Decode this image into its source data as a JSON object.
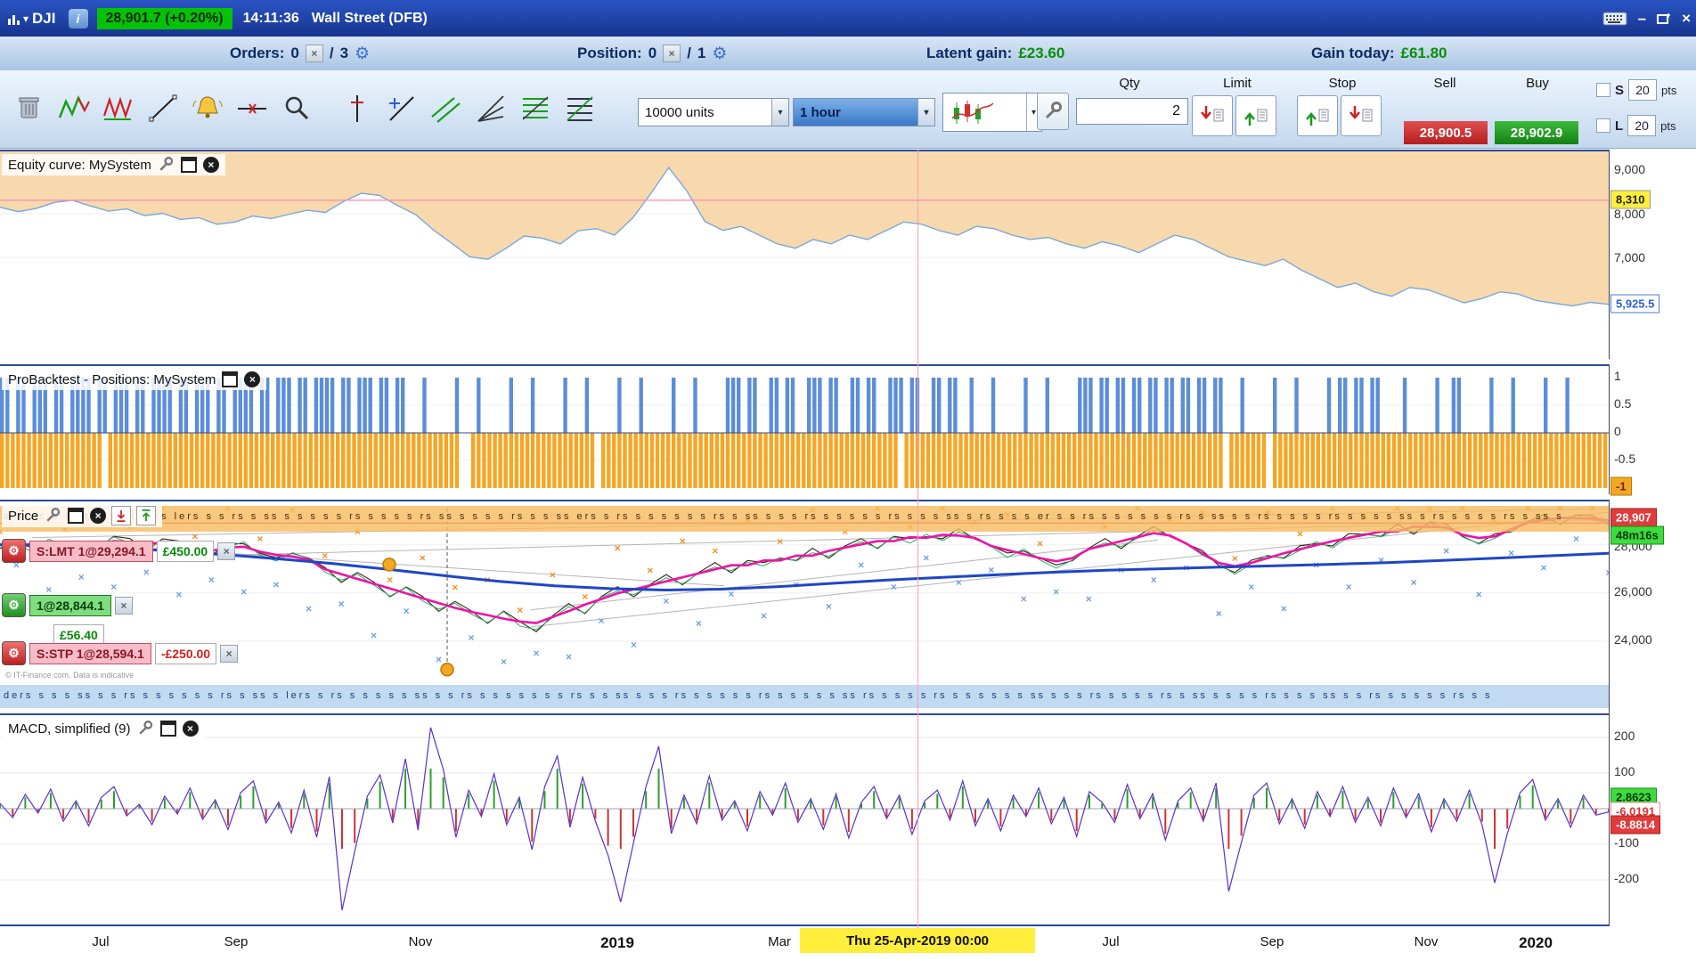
{
  "titlebar": {
    "symbol": "DJI",
    "info_icon": "i",
    "price_badge": "28,901.7 (+0.20%)",
    "time": "14:11:36",
    "market": "Wall Street (DFB)"
  },
  "icons": {
    "dropdown": "▾",
    "close": "×",
    "minimize": "–",
    "gear": "⚙"
  },
  "statusbar": {
    "orders_label": "Orders:",
    "orders_count": "0",
    "orders_sep": "/",
    "orders_total": "3",
    "position_label": "Position:",
    "position_count": "0",
    "position_sep": "/",
    "position_total": "1",
    "latent_label": "Latent gain:",
    "latent_value": "£23.60",
    "today_label": "Gain today:",
    "today_value": "£61.80"
  },
  "toolbar": {
    "units": "10000 units",
    "timeframe": "1 hour",
    "qty_label": "Qty",
    "qty_value": "2",
    "limit_label": "Limit",
    "stop_label": "Stop",
    "sell_label": "Sell",
    "buy_label": "Buy",
    "sell_price": "28,900.5",
    "buy_price": "28,902.9",
    "s_label": "S",
    "l_label": "L",
    "s_pts": "20",
    "l_pts": "20",
    "pts": "pts",
    "pts2": "pts"
  },
  "panels": {
    "equity": {
      "title": "Equity curve: MySystem",
      "axis": [
        "9,000",
        "8,000",
        "7,000"
      ],
      "marker": "8,310",
      "current": "5,925.5"
    },
    "positions": {
      "title": "ProBacktest - Positions: MySystem",
      "axis": [
        "1",
        "0.5",
        "0",
        "-0.5"
      ],
      "current": "-1"
    },
    "price": {
      "title": "Price",
      "price_tag": "28,907",
      "countdown": "48m16s",
      "axis": [
        "28,000",
        "26,000",
        "24,000"
      ],
      "orders": [
        {
          "type": "S:LMT 1@29,294.1",
          "value": "£450.00"
        },
        {
          "type": "1@28,844.1",
          "value": "£56.40"
        },
        {
          "type": "S:STP 1@28,594.1",
          "value": "-£250.00"
        }
      ],
      "watermark": "© IT-Finance.com. Data is indicative",
      "top_signals": "s ssss s s rs s s er s rs lers s s rs s ss s s s s s rs s s s s rs ss s s s s rs s s ss ers s rs s s s s s s rs s ss s s s rs s s s s s rs s s s ss s rs s s s er s s rs s s s s s s rs s ss s s rs s s s s rs s s s s ss s rs s s s s rs s ss s",
      "bottom_signals": "ders s s s ss s s rs s s s s s s rs s ss s lers s rs s s s s s ss s s rs s s s s s s s rs s s ss s s s rs s s s s s rs s s s s s ss rs s s s s rs s s s s s s ss s s s rs s s s s rs s ss s s s s rs s s s ss s s rs s s s s s rs s s"
    },
    "macd": {
      "title": "MACD, simplified (9)",
      "axis": [
        "200",
        "100",
        "-100",
        "-200"
      ],
      "tag_pos": "2.8623",
      "tag_mid": "-6.0191",
      "tag_neg": "-8.8814"
    }
  },
  "time_axis": {
    "labels": [
      "Jul",
      "Sep",
      "Nov",
      "2019",
      "Mar",
      "Jul",
      "Sep",
      "Nov",
      "2020"
    ],
    "crosshair": "Thu 25-Apr-2019 00:00"
  },
  "chart_data": {
    "equity": {
      "type": "line",
      "ylim": [
        5450,
        9430
      ],
      "ticks": [
        9000,
        8000,
        7000
      ],
      "marker_line": 8310,
      "last": 5925.5,
      "values": [
        8150,
        8050,
        8120,
        8260,
        8310,
        8180,
        8060,
        8110,
        7960,
        8010,
        7870,
        7910,
        7760,
        7810,
        7950,
        7890,
        7990,
        8080,
        8030,
        8280,
        8470,
        8420,
        8190,
        7980,
        7620,
        7320,
        7010,
        6960,
        7210,
        7490,
        7440,
        7310,
        7610,
        7660,
        7510,
        7900,
        8460,
        9060,
        8520,
        7820,
        7620,
        7710,
        7510,
        7310,
        7210,
        7410,
        7310,
        7510,
        7410,
        7610,
        7810,
        7760,
        7610,
        7510,
        7710,
        7660,
        7510,
        7410,
        7460,
        7310,
        7210,
        7360,
        7260,
        7110,
        7310,
        7510,
        7410,
        7210,
        7010,
        6910,
        6810,
        6960,
        6710,
        6510,
        6310,
        6410,
        6210,
        6110,
        6310,
        6260,
        6110,
        5960,
        6060,
        6210,
        6160,
        6010,
        5950,
        5890,
        5970,
        5925.5
      ]
    },
    "positions": {
      "type": "bar",
      "ylim": [
        -1,
        1
      ],
      "blue": "110110111011011110110111011011110110111011011110110111011011110110111011011000100000100010000010001000001000100000100010000010001000001110110011011001110110011011001110110011011001000100000100010000011101101101101101101101101100010000010001000001011011011000010000010011000001000100000100010",
      "orange": "111111111111111111101111111111111111111111111111111111111111111111111111111111111111100111111111111111111111110111111111111111111111111111111111111111111111111111111101111111111111111111111111111111111111111111111111111111111101111111011111111111111111111111111111111111111111111111111111111111111"
    },
    "price": {
      "type": "line",
      "ylim": [
        21000,
        29800
      ],
      "current": 28900,
      "values": [
        27950,
        28150,
        27750,
        28250,
        28050,
        27650,
        27950,
        28350,
        28150,
        27850,
        28250,
        28050,
        27750,
        27550,
        27950,
        28150,
        27650,
        27350,
        27750,
        27450,
        26950,
        26550,
        26850,
        26350,
        25950,
        26250,
        25750,
        25350,
        25650,
        25150,
        24850,
        25250,
        24700,
        24500,
        25050,
        25450,
        25250,
        25850,
        26150,
        25950,
        26350,
        26650,
        26450,
        26850,
        27150,
        26950,
        27350,
        27150,
        27550,
        27350,
        27750,
        27550,
        27950,
        28150,
        27950,
        28350,
        28150,
        28450,
        28250,
        28550,
        28350,
        27950,
        27550,
        27850,
        27450,
        27050,
        27450,
        27850,
        28150,
        27950,
        28350,
        28650,
        28450,
        28050,
        27650,
        27250,
        26850,
        27250,
        27650,
        27450,
        27850,
        28150,
        27950,
        28350,
        28550,
        28350,
        28750,
        28550,
        28950,
        28750,
        28450,
        28050,
        28350,
        28650,
        28950,
        29150,
        28950,
        29250,
        29100,
        28950
      ],
      "ma_values": [
        28000,
        27960,
        27880,
        27760,
        27600,
        27420,
        27220,
        26980,
        26720,
        26480,
        26300,
        26180,
        26120,
        26160,
        26260,
        26400,
        26540,
        26650,
        26760,
        26860,
        26950,
        27010,
        27070,
        27130,
        27190,
        27260,
        27350,
        27450,
        27550,
        27650
      ],
      "trendlines": [
        [
          0.02,
          28300,
          1.0,
          29500
        ],
        [
          0.1,
          27500,
          1.0,
          29050
        ],
        [
          0.33,
          24600,
          1.0,
          29350
        ],
        [
          0.33,
          25300,
          0.72,
          28200
        ],
        [
          0.05,
          28050,
          0.45,
          26300
        ]
      ],
      "circles": [
        [
          0.242,
          27180
        ],
        [
          0.278,
          22820
        ]
      ],
      "dashed_x": 0.278
    },
    "macd": {
      "type": "line",
      "ylim": [
        -290,
        230
      ],
      "values": [
        15,
        -25,
        40,
        -12,
        55,
        -35,
        22,
        -48,
        32,
        62,
        -20,
        12,
        -45,
        35,
        -15,
        58,
        -30,
        25,
        -58,
        45,
        78,
        -40,
        18,
        -68,
        52,
        -80,
        90,
        -288,
        -120,
        35,
        95,
        -40,
        140,
        -60,
        228,
        110,
        -80,
        52,
        -22,
        98,
        -45,
        32,
        -115,
        62,
        148,
        -52,
        88,
        -35,
        -130,
        -262,
        -98,
        62,
        175,
        -70,
        38,
        -42,
        92,
        -32,
        22,
        -62,
        48,
        -18,
        72,
        -38,
        28,
        -58,
        42,
        -82,
        18,
        62,
        -28,
        38,
        -72,
        22,
        52,
        -32,
        78,
        -48,
        28,
        -62,
        38,
        -22,
        58,
        -42,
        32,
        -78,
        48,
        18,
        -38,
        68,
        -28,
        42,
        -88,
        22,
        58,
        -35,
        72,
        -232,
        -95,
        38,
        72,
        -42,
        28,
        -55,
        48,
        -22,
        62,
        -38,
        32,
        -48,
        58,
        -25,
        42,
        -65,
        28,
        -35,
        52,
        -45,
        -208,
        -70,
        45,
        82,
        -32,
        28,
        -52,
        38,
        -18,
        -8.9
      ]
    }
  }
}
